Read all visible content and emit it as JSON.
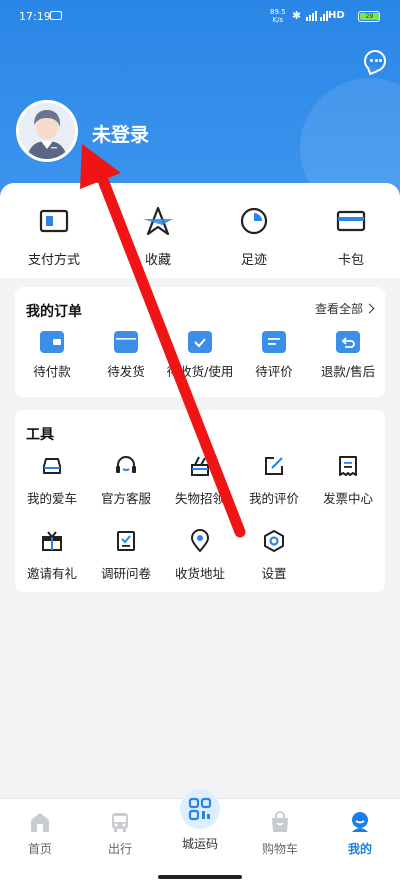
{
  "status_bar": {
    "time": "17:19",
    "net_speed_value": "89.5",
    "net_speed_unit": "K/s",
    "hd": "HD",
    "battery": "29"
  },
  "header": {
    "login_label": "未登录"
  },
  "quick_actions": [
    {
      "label": "支付方式",
      "icon": "wallet-card-icon"
    },
    {
      "label": "收藏",
      "icon": "star-icon"
    },
    {
      "label": "足迹",
      "icon": "history-icon"
    },
    {
      "label": "卡包",
      "icon": "card-icon"
    }
  ],
  "orders": {
    "title": "我的订单",
    "view_all": "查看全部",
    "items": [
      {
        "label": "待付款",
        "icon": "wallet-icon"
      },
      {
        "label": "待发货",
        "icon": "box-icon"
      },
      {
        "label": "待收货/使用",
        "icon": "inbox-check-icon"
      },
      {
        "label": "待评价",
        "icon": "comment-icon"
      },
      {
        "label": "退款/售后",
        "icon": "refund-icon"
      }
    ]
  },
  "tools": {
    "title": "工具",
    "items": [
      {
        "label": "我的爱车",
        "icon": "car-icon"
      },
      {
        "label": "官方客服",
        "icon": "headset-icon"
      },
      {
        "label": "失物招领",
        "icon": "lost-found-icon"
      },
      {
        "label": "我的评价",
        "icon": "edit-icon"
      },
      {
        "label": "发票中心",
        "icon": "invoice-icon"
      },
      {
        "label": "邀请有礼",
        "icon": "gift-icon"
      },
      {
        "label": "调研问卷",
        "icon": "survey-icon"
      },
      {
        "label": "收货地址",
        "icon": "location-icon"
      },
      {
        "label": "设置",
        "icon": "settings-icon"
      }
    ]
  },
  "tabbar": [
    {
      "label": "首页",
      "icon": "home-icon"
    },
    {
      "label": "出行",
      "icon": "bus-icon"
    },
    {
      "label": "城运码",
      "icon": "qr-code-icon"
    },
    {
      "label": "购物车",
      "icon": "cart-icon"
    },
    {
      "label": "我的",
      "icon": "profile-icon",
      "active": true
    }
  ],
  "colors": {
    "primary": "#2a86e6",
    "active_tab": "#1c7de4",
    "annotation_arrow": "#f01414"
  }
}
